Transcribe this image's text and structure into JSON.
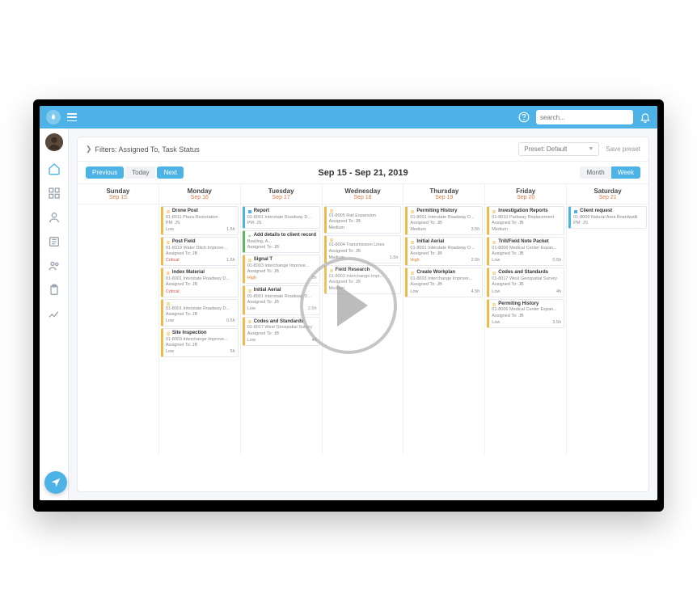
{
  "topbar": {
    "search_placeholder": "search..."
  },
  "filters": {
    "label": "Filters: Assigned To, Task Status",
    "preset_label": "Preset: Default",
    "save_label": "Save preset"
  },
  "nav": {
    "previous": "Previous",
    "today": "Today",
    "next": "Next",
    "month": "Month",
    "week": "Week"
  },
  "date_range": "Sep 15 - Sep 21, 2019",
  "days": [
    {
      "name": "Sunday",
      "date": "Sep 15"
    },
    {
      "name": "Monday",
      "date": "Sep 16"
    },
    {
      "name": "Tuesday",
      "date": "Sep 17"
    },
    {
      "name": "Wednesday",
      "date": "Sep 18"
    },
    {
      "name": "Thursday",
      "date": "Sep 19"
    },
    {
      "name": "Friday",
      "date": "Sep 20"
    },
    {
      "name": "Saturday",
      "date": "Sep 21"
    }
  ],
  "columns": [
    [],
    [
      {
        "title": "Drone Post",
        "sub": "01-8011 Plaza Restoration",
        "assigned": "PM: JS",
        "prio": "Low",
        "hours": "1.5h",
        "type": "yellow"
      },
      {
        "title": "Post Field",
        "sub": "01-8019 Water Ditch Improve...",
        "assigned": "Assigned To: JB",
        "prio": "Critical",
        "hours": "1.5h",
        "type": "yellow"
      },
      {
        "title": "Index Material",
        "sub": "01-8001 Interstate Roadway D...",
        "assigned": "Assigned To: JB",
        "prio": "Critical",
        "hours": "",
        "type": "yellow"
      },
      {
        "title": "",
        "sub": "01-8001 Interstate Roadway D...",
        "assigned": "Assigned To: JB",
        "prio": "Low",
        "hours": "0.5h",
        "type": "yellow"
      },
      {
        "title": "Site Inspection",
        "sub": "01-8003 Interchange Improve...",
        "assigned": "Assigned To: JB",
        "prio": "Low",
        "hours": "5h",
        "type": "yellow"
      }
    ],
    [
      {
        "title": "Report",
        "sub": "01-8001 Interstate Roadway D...",
        "assigned": "PM: JS",
        "prio": "",
        "hours": "",
        "type": "blue"
      },
      {
        "title": "Add details to client record",
        "sub": "Bowling, A...",
        "assigned": "Assigned To: JB",
        "prio": "",
        "hours": "",
        "type": "green"
      },
      {
        "title": "Signal T",
        "sub": "01-8003 Interchange Improve...",
        "assigned": "Assigned To: JB",
        "prio": "High",
        "hours": "2h",
        "type": "yellow"
      },
      {
        "title": "Initial Aerial",
        "sub": "01-8001 Interstate Roadway D...",
        "assigned": "Assigned To: JB",
        "prio": "Low",
        "hours": "2.5h",
        "type": "yellow"
      },
      {
        "title": "Codes and Standards",
        "sub": "01-8017 West Geospatial Survey",
        "assigned": "Assigned To: JB",
        "prio": "Low",
        "hours": "4h",
        "type": "yellow"
      }
    ],
    [
      {
        "title": "",
        "sub": "01-8005 Rail Expansion",
        "assigned": "Assigned To: JB",
        "prio": "Medium",
        "hours": "",
        "type": "yellow"
      },
      {
        "title": "",
        "sub": "01-8004 Transmission Lines",
        "assigned": "Assigned To: JB",
        "prio": "Medium",
        "hours": "1.5h",
        "type": "yellow"
      },
      {
        "title": "Field Research",
        "sub": "01-8003 Interchange Impr...",
        "assigned": "Assigned To: JB",
        "prio": "Medium",
        "hours": "",
        "type": "yellow"
      }
    ],
    [
      {
        "title": "Permiting History",
        "sub": "01-8001 Interstate Roadway D...",
        "assigned": "Assigned To: JB",
        "prio": "Medium",
        "hours": "3.5h",
        "type": "yellow"
      },
      {
        "title": "Initial Aerial",
        "sub": "01-8001 Interstate Roadway D...",
        "assigned": "Assigned To: JB",
        "prio": "High",
        "hours": "2.5h",
        "type": "yellow"
      },
      {
        "title": "Create Workplan",
        "sub": "01-8003 Interchange Improve...",
        "assigned": "Assigned To: JB",
        "prio": "Low",
        "hours": "4.5h",
        "type": "yellow"
      }
    ],
    [
      {
        "title": "Investigation Reports",
        "sub": "01-8010 Parkway Replacement",
        "assigned": "Assigned To: JB",
        "prio": "Medium",
        "hours": "",
        "type": "yellow"
      },
      {
        "title": "Trill/Field Note Packet",
        "sub": "01-8006 Medical Center Expan...",
        "assigned": "Assigned To: JB",
        "prio": "Low",
        "hours": "0.5h",
        "type": "yellow"
      },
      {
        "title": "Codes and Standards",
        "sub": "01-8017 West Geospatial Survey",
        "assigned": "Assigned To: JB",
        "prio": "Low",
        "hours": "4h",
        "type": "yellow"
      },
      {
        "title": "Permiting History",
        "sub": "01-8006 Medical Center Expan...",
        "assigned": "Assigned To: JB",
        "prio": "Low",
        "hours": "3.5h",
        "type": "yellow"
      }
    ],
    [
      {
        "title": "Client request",
        "sub": "01-8009 Natural Area Boardwalk",
        "assigned": "PM: JS",
        "prio": "",
        "hours": "",
        "type": "blue"
      }
    ]
  ]
}
